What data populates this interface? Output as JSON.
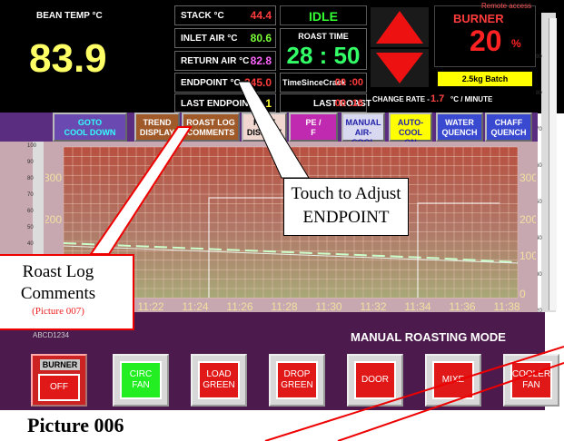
{
  "top_left": {
    "bean_temp_label": "BEAN TEMP °C",
    "bean_temp_value": "83.9"
  },
  "readings": [
    {
      "label": "STACK °C",
      "value": "44.4",
      "color": "#ff3b3b"
    },
    {
      "label": "INLET AIR °C",
      "value": "80.6",
      "color": "#7cff3a"
    },
    {
      "label": "RETURN AIR °C",
      "value": "82.8",
      "color": "#ff66ff"
    },
    {
      "label": "ENDPOINT °C",
      "value": "245.0",
      "color": "#ff3b3b"
    },
    {
      "label": "LAST ENDPOINT",
      "value": "91.1",
      "color": "#ffff33"
    }
  ],
  "status": {
    "state": "IDLE",
    "roast_time_label": "ROAST TIME",
    "roast_time_value": "28 : 50",
    "since_crack_label": "TimeSinceCrack",
    "since_crack_value": "00 :00",
    "last_roast_label": "LAST ROAST",
    "last_roast_value": "00 :16"
  },
  "burner": {
    "label": "BURNER",
    "value": "20",
    "unit": "%",
    "batch": "2.5kg Batch",
    "remote": "Remote access",
    "change_rate_label": "CHANGE RATE -",
    "change_rate_value": "1.7",
    "change_rate_unit": "°C / MINUTE"
  },
  "strip_buttons": [
    {
      "line1": "GOTO",
      "line2": "COOL DOWN"
    },
    {
      "line1": "TREND",
      "line2": "DISPLAY"
    },
    {
      "line1": "ROAST LOG",
      "line2": "COMMENTS"
    },
    {
      "line1": "PLOT",
      "line2": "DISPLAY"
    },
    {
      "line1": "PE /",
      "line2": "F"
    },
    {
      "line1": "MANUAL",
      "line2": "AIR-COOL"
    },
    {
      "line1": "AUTO-COOL",
      "line2": "ON"
    },
    {
      "line1": "WATER",
      "line2": "QUENCH"
    },
    {
      "line1": "CHAFF",
      "line2": "QUENCH"
    }
  ],
  "chart": {
    "left_ticks": [
      "300",
      "200",
      "100"
    ],
    "right_ticks": [
      "300",
      "200",
      "100",
      "0"
    ],
    "x_ticks": [
      "11:22",
      "11:24",
      "11:26",
      "11:28",
      "11:30",
      "11:32",
      "11:34",
      "11:36",
      "11:38"
    ]
  },
  "left_scale_ticks": [
    "100",
    "90",
    "80",
    "70",
    "60",
    "50",
    "40"
  ],
  "right_scale_ticks": [
    "90",
    "80",
    "70",
    "60",
    "50",
    "40",
    "30",
    "20"
  ],
  "mode": {
    "label": "MANUAL ROASTING MODE",
    "code": "ABCD1234"
  },
  "control_buttons": [
    {
      "caption": "BURNER",
      "text": "OFF"
    },
    {
      "text": "CIRC FAN"
    },
    {
      "text": "LOAD GREEN"
    },
    {
      "text": "DROP GREEN"
    },
    {
      "text": "DOOR"
    },
    {
      "text": "MIXE"
    },
    {
      "text": "COOLER FAN"
    }
  ],
  "callouts": {
    "adjust_line1": "Touch to Adjust",
    "adjust_line2": "ENDPOINT",
    "roastlog_line1": "Roast Log",
    "roastlog_line2": "Comments",
    "roastlog_pic": "(Picture 007)"
  },
  "picture_label": "Picture 006"
}
